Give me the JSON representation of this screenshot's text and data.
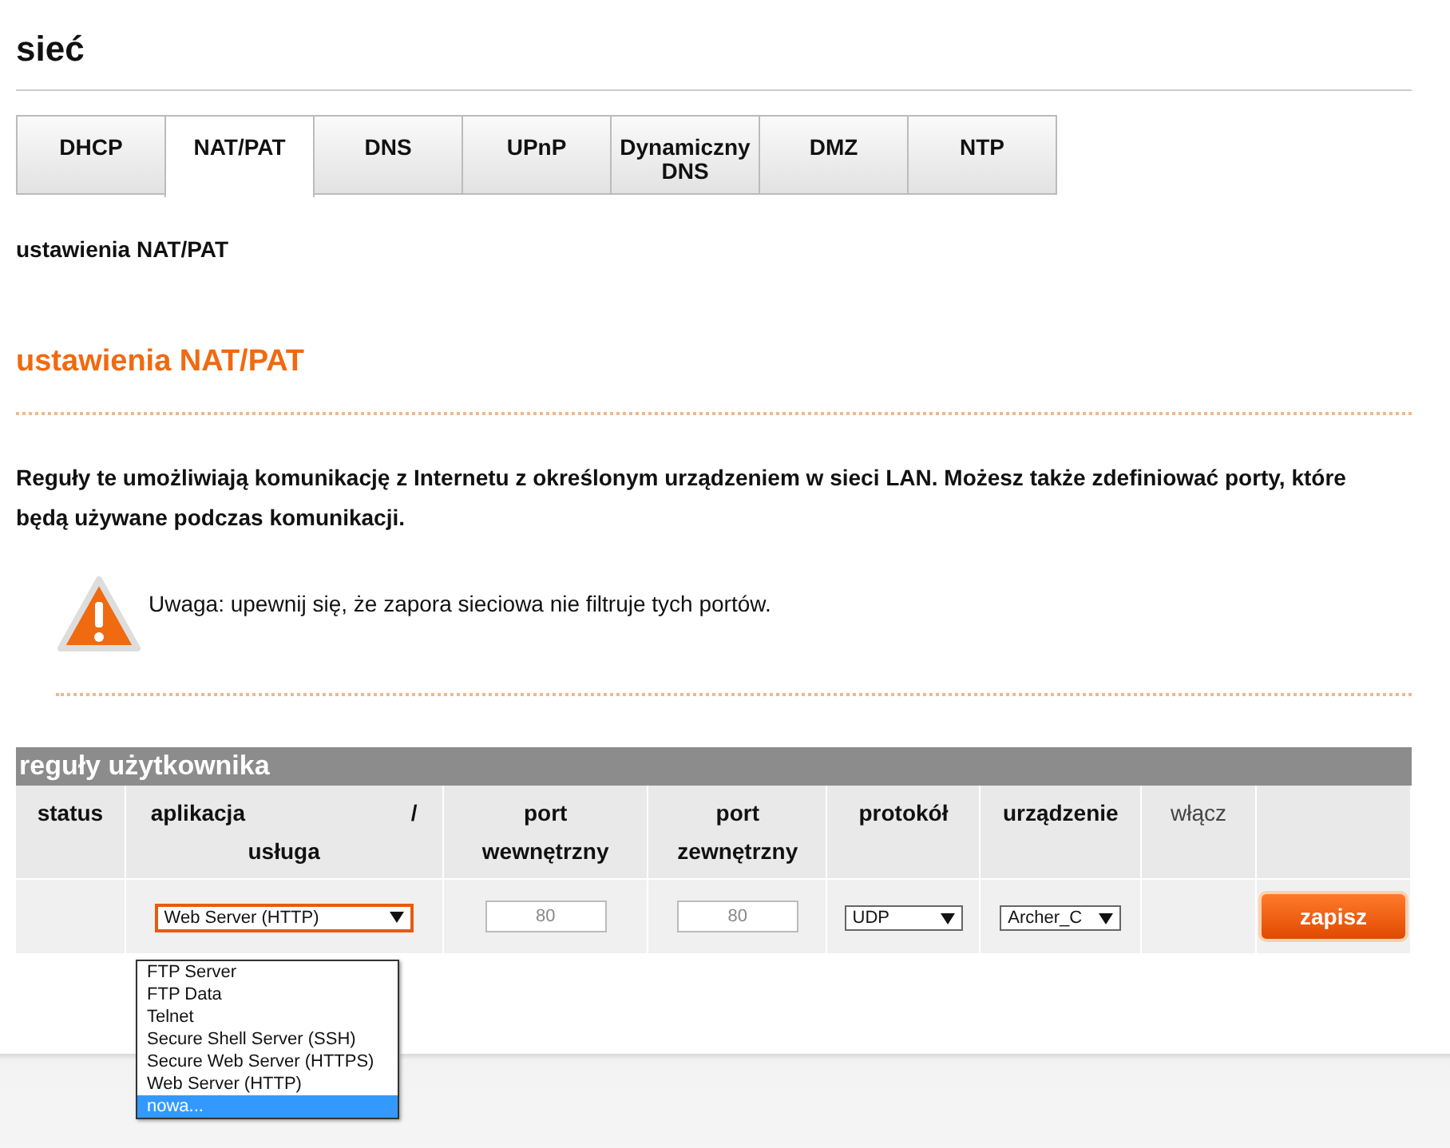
{
  "page": {
    "title": "sieć"
  },
  "tabs": [
    {
      "label": "DHCP",
      "selected": false
    },
    {
      "label": "NAT/PAT",
      "selected": true
    },
    {
      "label": "DNS",
      "selected": false
    },
    {
      "label": "UPnP",
      "selected": false
    },
    {
      "label": "Dynamiczny DNS",
      "selected": false
    },
    {
      "label": "DMZ",
      "selected": false
    },
    {
      "label": "NTP",
      "selected": false
    }
  ],
  "breadcrumb": "ustawienia NAT/PAT",
  "section": {
    "title": "ustawienia NAT/PAT",
    "description": "Reguły te umożliwiają komunikację z Internetu z określonym urządzeniem w sieci LAN. Możesz także zdefiniować porty, które będą używane podczas komunikacji.",
    "warning": "Uwaga: upewnij się, że zapora sieciowa nie filtruje tych portów."
  },
  "rules": {
    "title": "reguły użytkownika",
    "columns": [
      {
        "label": "status",
        "bold": true
      },
      {
        "label": "aplikacja / usługa",
        "bold": true
      },
      {
        "label": "port wewnętrzny",
        "bold": true
      },
      {
        "label": "port zewnętrzny",
        "bold": true
      },
      {
        "label": "protokół",
        "bold": true
      },
      {
        "label": "urządzenie",
        "bold": true
      },
      {
        "label": "włącz",
        "bold": false
      }
    ],
    "row": {
      "application": "Web Server (HTTP)",
      "internal_port": "80",
      "external_port": "80",
      "protocol": "UDP",
      "device": "Archer_C",
      "save_button": "zapisz"
    },
    "application_options": [
      {
        "label": "FTP Server",
        "selected": false
      },
      {
        "label": "FTP Data",
        "selected": false
      },
      {
        "label": "Telnet",
        "selected": false
      },
      {
        "label": "Secure Shell Server (SSH)",
        "selected": false
      },
      {
        "label": "Secure Web Server (HTTPS)",
        "selected": false
      },
      {
        "label": "Web Server (HTTP)",
        "selected": false
      },
      {
        "label": "nowa...",
        "selected": true
      }
    ]
  }
}
